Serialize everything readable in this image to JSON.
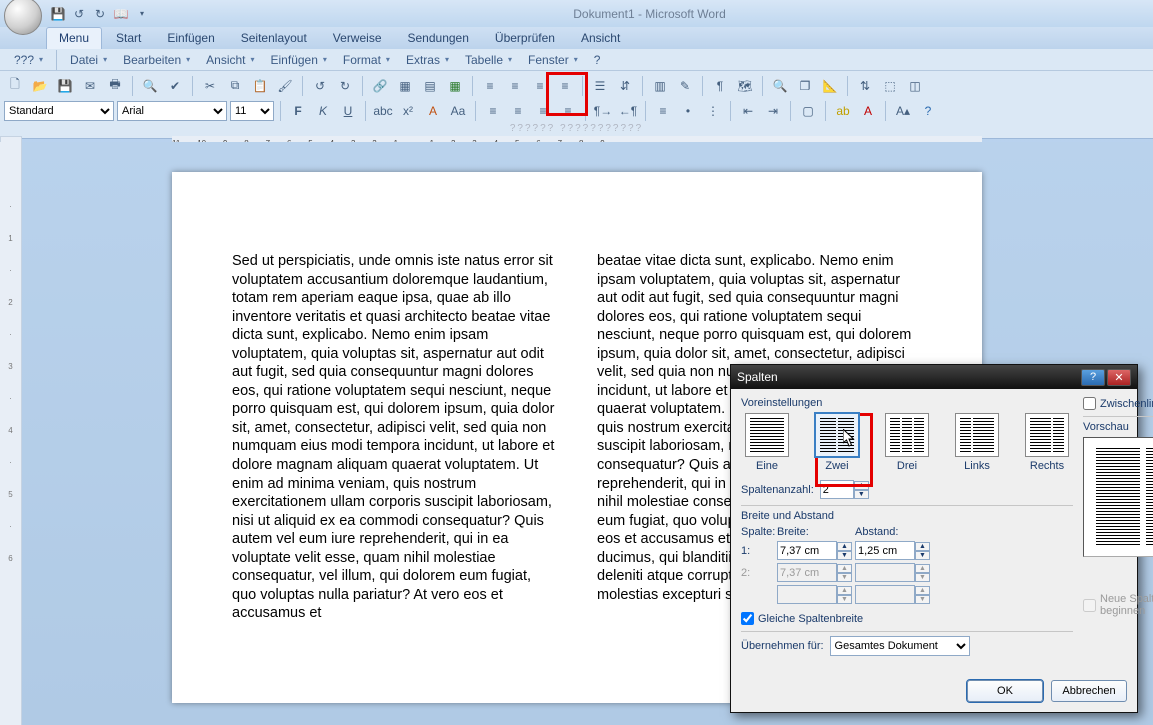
{
  "app_title": "Dokument1 - Microsoft Word",
  "tabs": [
    "Menu",
    "Start",
    "Einfügen",
    "Seitenlayout",
    "Verweise",
    "Sendungen",
    "Überprüfen",
    "Ansicht"
  ],
  "menus": [
    "???",
    "Datei",
    "Bearbeiten",
    "Ansicht",
    "Einfügen",
    "Format",
    "Extras",
    "Tabelle",
    "Fenster",
    "?"
  ],
  "style_combo": "Standard",
  "font_combo": "Arial",
  "size_combo": "11",
  "placeholder_label": "?????? ???????????",
  "hruler": "11 · · · 10 · · · 9 · · · 8 · · · 7 · · · 6 · · · 5 · · · 4 · · · 3 · · · 2 · · · 1 · · · · · · 1 · · · 2 · · · 3 · · · 4 · · · 5 · · · 6 · · · 7 · · · 8 · · · 9 · · · ·",
  "doc": {
    "col1": "Sed ut perspiciatis, unde omnis iste natus error sit voluptatem accusantium doloremque laudantium, totam rem aperiam eaque ipsa, quae ab illo inventore veritatis et quasi architecto beatae vitae dicta sunt, explicabo. Nemo enim ipsam voluptatem, quia voluptas sit, aspernatur aut odit aut fugit, sed quia consequuntur magni dolores eos, qui ratione voluptatem sequi nesciunt, neque porro quisquam est, qui dolorem ipsum, quia dolor sit, amet, consectetur, adipisci velit, sed quia non numquam eius modi tempora incidunt, ut labore et dolore magnam aliquam quaerat voluptatem. Ut enim ad minima veniam, quis nostrum exercitationem ullam corporis suscipit laboriosam, nisi ut aliquid ex ea commodi consequatur? Quis autem vel eum iure reprehenderit, qui in ea voluptate velit esse, quam nihil molestiae consequatur, vel illum, qui dolorem eum fugiat, quo voluptas nulla pariatur? At vero eos et accusamus et",
    "col2": "beatae vitae dicta sunt, explicabo. Nemo enim ipsam voluptatem, quia voluptas sit, aspernatur aut odit aut fugit, sed quia consequuntur magni dolores eos, qui ratione voluptatem sequi nesciunt, neque porro quisquam est, qui dolorem ipsum, quia dolor sit, amet, consectetur, adipisci velit, sed quia non numquam eius modi tempora incidunt, ut labore et dolore magnam aliquam quaerat voluptatem. Ut enim ad minima veniam, quis nostrum exercitationem ullam corporis suscipit laboriosam, nisi ut aliquid ex ea commodi consequatur? Quis autem vel eum iure reprehenderit, qui in ea voluptate velit esse, quam nihil molestiae consequatur, vel illum, qui dolorem eum fugiat, quo voluptas nulla pariatur? At vero eos et accusamus et iusto odio dignissimos ducimus, qui blanditiis praesentium voluptatum deleniti atque corrupti, quos dolores et quas molestias excepturi sint, obcaecati"
  },
  "dialog": {
    "title": "Spalten",
    "presets_label": "Voreinstellungen",
    "presets": [
      "Eine",
      "Zwei",
      "Drei",
      "Links",
      "Rechts"
    ],
    "selected_preset": 1,
    "count_label": "Spaltenanzahl:",
    "count_value": "2",
    "zwischen_label": "Zwischenlinie",
    "section_label": "Breite und Abstand",
    "col_header": "Spalte:",
    "width_header": "Breite:",
    "gap_header": "Abstand:",
    "r1_col": "1:",
    "r1_width": "7,37 cm",
    "r1_gap": "1,25 cm",
    "r2_col": "2:",
    "r2_width": "7,37 cm",
    "r2_gap": "",
    "equal_label": "Gleiche Spaltenbreite",
    "preview_label": "Vorschau",
    "apply_label": "Übernehmen für:",
    "apply_value": "Gesamtes Dokument",
    "newcol_label": "Neue Spalte beginnen",
    "ok": "OK",
    "cancel": "Abbrechen"
  }
}
